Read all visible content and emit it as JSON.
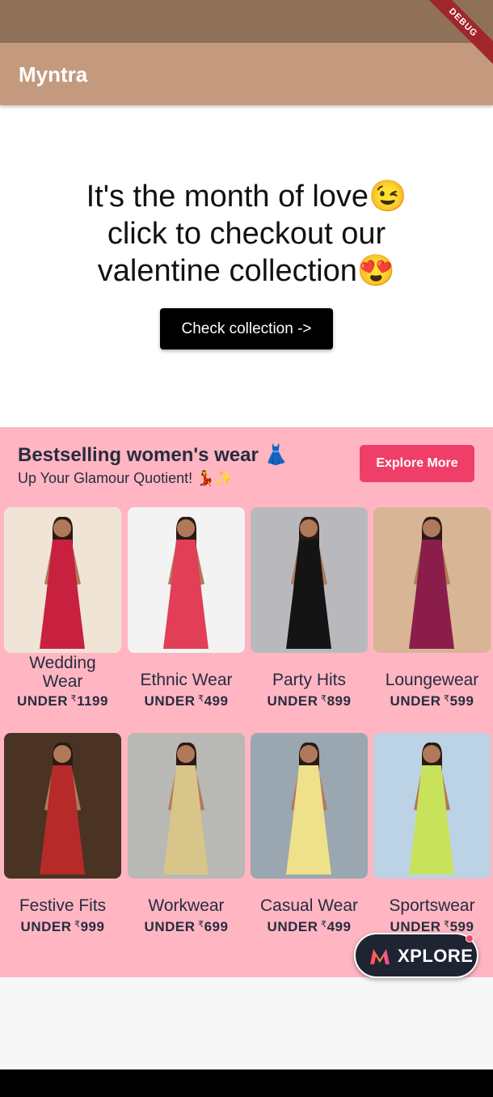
{
  "app": {
    "title": "Myntra",
    "debug_label": "DEBUG"
  },
  "hero": {
    "line1": "It's the month of love😉",
    "line2": "click to checkout our",
    "line3": "valentine collection😍",
    "button_label": "Check collection ->"
  },
  "bestselling": {
    "title": "Bestselling women's wear 👗",
    "subtitle": "Up Your Glamour Quotient! 💃✨",
    "explore_label": "Explore More",
    "categories": [
      {
        "label": "Wedding Wear",
        "price": "1199",
        "prefix": "UNDER",
        "bg": "#efe4d6",
        "outfit": "#c8213f"
      },
      {
        "label": "Ethnic Wear",
        "price": "499",
        "prefix": "UNDER",
        "bg": "#f3f3f3",
        "outfit": "#e33e57"
      },
      {
        "label": "Party Hits",
        "price": "899",
        "prefix": "UNDER",
        "bg": "#b9b9bd",
        "outfit": "#141414"
      },
      {
        "label": "Loungewear",
        "price": "599",
        "prefix": "UNDER",
        "bg": "#d8b595",
        "outfit": "#8b1d4b"
      },
      {
        "label": "Festive Fits",
        "price": "999",
        "prefix": "UNDER",
        "bg": "#4a3323",
        "outfit": "#b72a2a"
      },
      {
        "label": "Workwear",
        "price": "699",
        "prefix": "UNDER",
        "bg": "#b8b8b4",
        "outfit": "#d7c58a"
      },
      {
        "label": "Casual Wear",
        "price": "499",
        "prefix": "UNDER",
        "bg": "#9aa7b0",
        "outfit": "#efe08a"
      },
      {
        "label": "Sportswear",
        "price": "599",
        "prefix": "UNDER",
        "bg": "#bcd3e6",
        "outfit": "#c9e25b"
      }
    ]
  },
  "xplore": {
    "label": "XPLORE"
  },
  "colors": {
    "app_bar": "#c49a7e",
    "status_bar": "#8f7158",
    "pink_section": "#ffb6c2",
    "explore_button": "#ef3f68"
  }
}
